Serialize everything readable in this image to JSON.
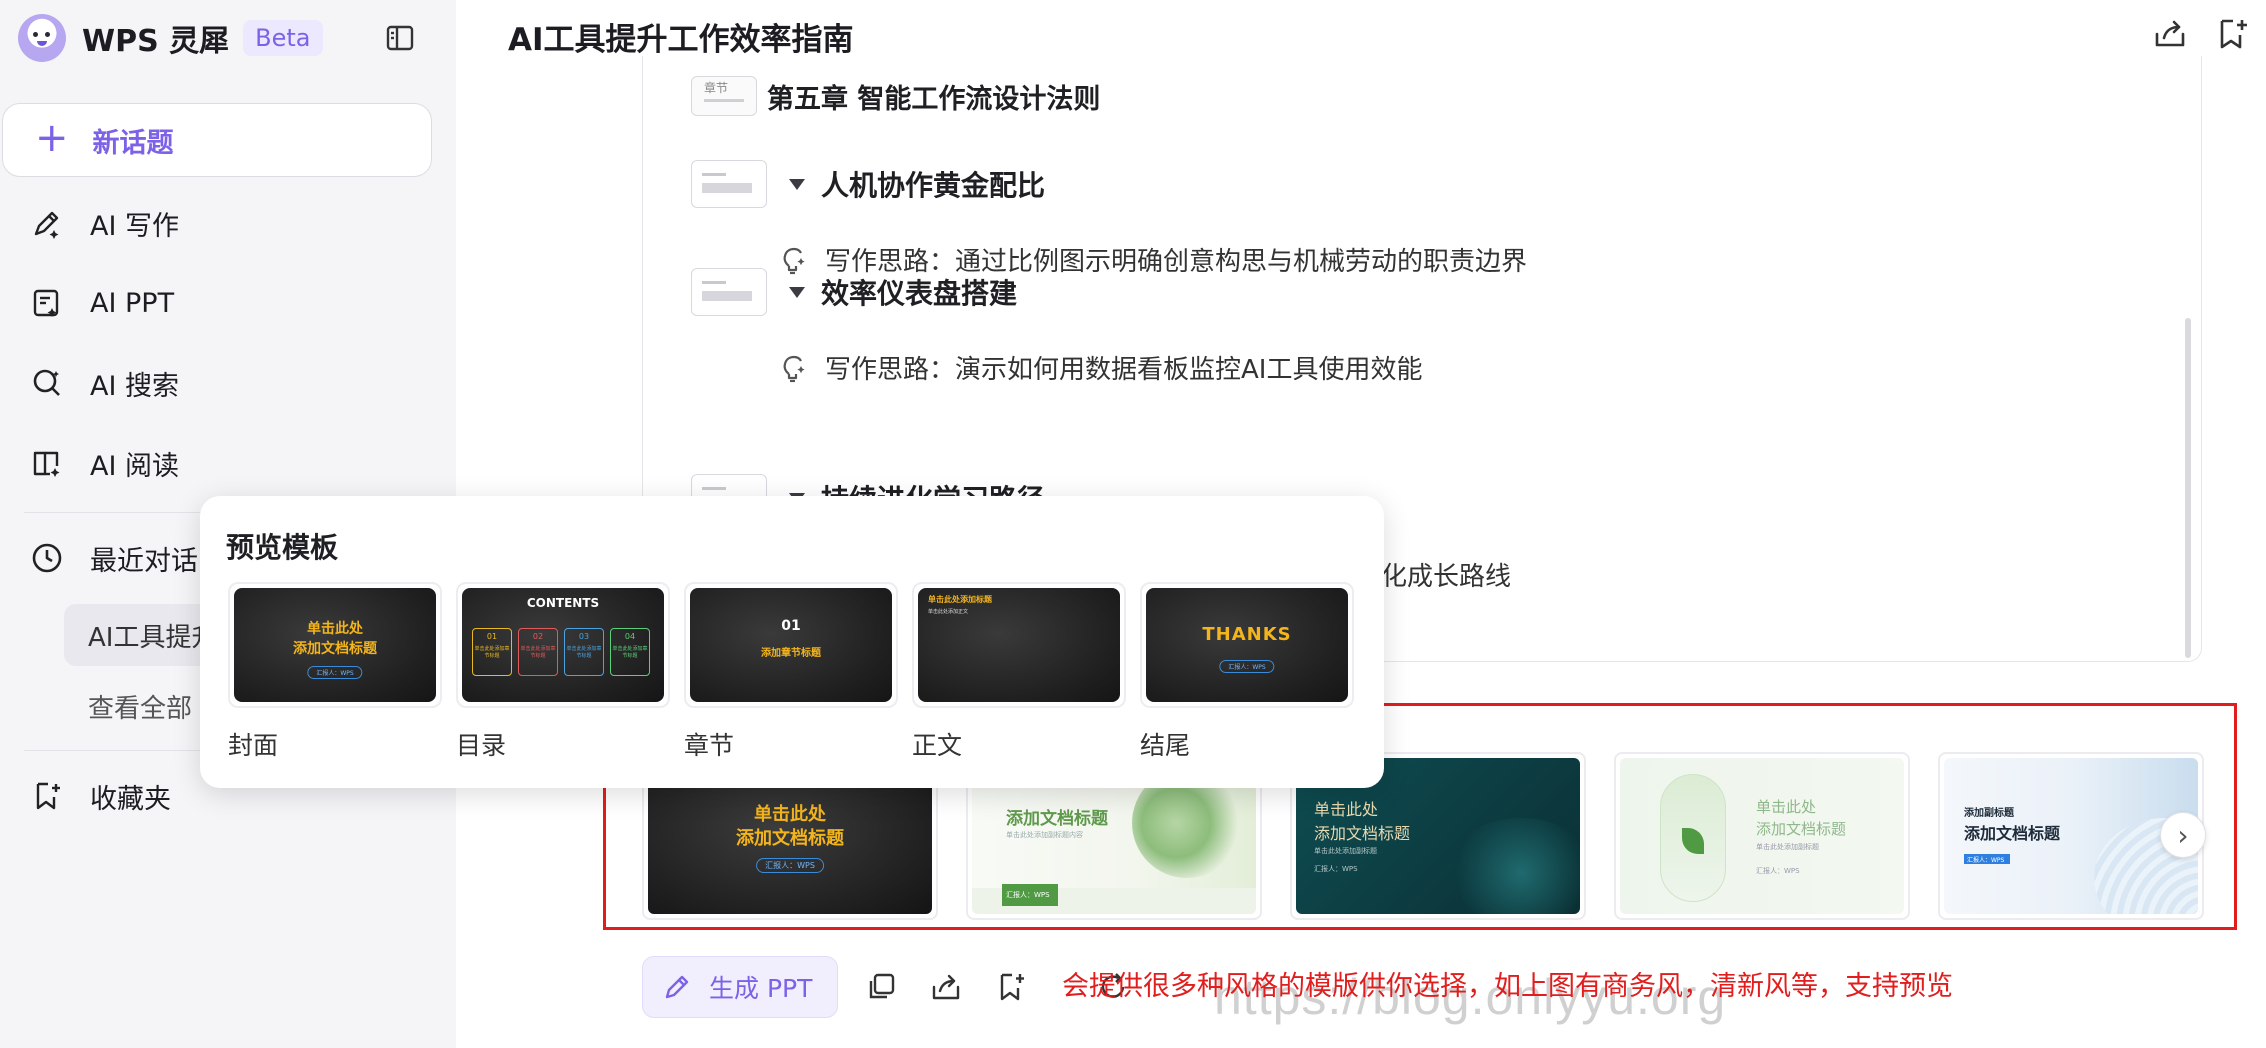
{
  "app": {
    "name": "WPS 灵犀",
    "badge": "Beta"
  },
  "sidebar": {
    "new_topic": "新话题",
    "items": [
      {
        "label": "AI 写作",
        "icon": "pen-sparkle-icon"
      },
      {
        "label": "AI PPT",
        "icon": "slides-icon"
      },
      {
        "label": "AI 搜索",
        "icon": "search-sparkle-icon"
      },
      {
        "label": "AI 阅读",
        "icon": "book-icon"
      }
    ],
    "recent_label": "最近对话",
    "recent_items": [
      "AI工具提升工作效率指南"
    ],
    "see_all": "查看全部",
    "favorites": "收藏夹"
  },
  "header": {
    "title": "AI工具提升工作效率指南"
  },
  "outline": {
    "chapter_badge": "章节",
    "chapter_title": "第五章 智能工作流设计法则",
    "sections": [
      {
        "title": "人机协作黄金配比",
        "idea": "写作思路：通过比例图示明确创意构思与机械劳动的职责边界"
      },
      {
        "title": "效率仪表盘搭建",
        "idea": "写作思路：演示如何用数据看板监控AI工具使用效能"
      },
      {
        "title": "持续进化学习路径",
        "idea": "化成长路线"
      }
    ]
  },
  "preview_popup": {
    "title": "预览模板",
    "cover": {
      "line1": "单击此处",
      "line2": "添加文档标题",
      "tag": "汇报人：WPS"
    },
    "toc": {
      "heading": "CONTENTS",
      "nums": [
        "01",
        "02",
        "03",
        "04"
      ],
      "item": "单击此处添加章节标题"
    },
    "section": {
      "num": "01",
      "title": "添加章节标题"
    },
    "body": {
      "title": "单击此处添加标题",
      "sub": "单击此处添加正文"
    },
    "ending": {
      "text": "THANKS",
      "tag": "汇报人：WPS"
    },
    "labels": [
      "封面",
      "目录",
      "章节",
      "正文",
      "结尾"
    ]
  },
  "templates": [
    {
      "line1": "单击此处",
      "line2": "添加文档标题",
      "tag": "汇报人：WPS"
    },
    {
      "title": "添加文档标题",
      "sub": "单击此处添加副标题内容",
      "tag": "汇报人：WPS"
    },
    {
      "line1": "单击此处",
      "line2": "添加文档标题",
      "sub": "单击此处添加副标题",
      "tag": "汇报人：WPS"
    },
    {
      "line1": "单击此处",
      "line2": "添加文档标题",
      "sub": "单击此处添加副标题",
      "tag": "汇报人：WPS"
    },
    {
      "line1": "添加副标题",
      "line2": "添加文档标题",
      "tag": "汇报人：WPS"
    }
  ],
  "actions": {
    "generate": "生成 PPT"
  },
  "annotation": "会提供很多种风格的模版供你选择，如上图有商务风，清新风等，支持预览",
  "watermark": "https://blog.onlyyu.org",
  "colors": {
    "accent": "#7d62e8",
    "annotation_red": "#e11d1d",
    "chalk_yellow": "#f3b41c"
  }
}
